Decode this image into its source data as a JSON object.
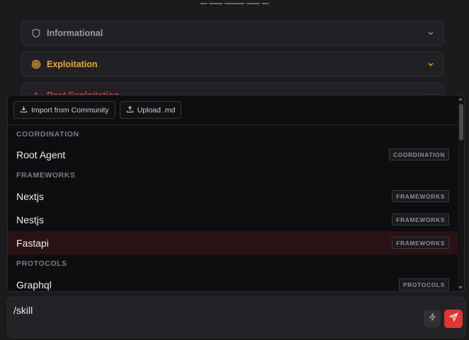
{
  "top_fragment": "▁ ▁▁ ▁▁▁  ▁▁ ▁",
  "categories": [
    {
      "label": "Informational",
      "icon": "shield-icon",
      "color": "#9a9aa0"
    },
    {
      "label": "Exploitation",
      "icon": "target-icon",
      "color": "#f5a524"
    },
    {
      "label": "Post Exploitation",
      "icon": "post-exploit-icon",
      "color": "#c24141"
    }
  ],
  "popover": {
    "import_label": "Import from Community",
    "upload_label": "Upload .md",
    "sections": [
      {
        "title": "COORDINATION",
        "items": [
          {
            "name": "Root Agent",
            "tag": "COORDINATION"
          }
        ]
      },
      {
        "title": "FRAMEWORKS",
        "items": [
          {
            "name": "Nextjs",
            "tag": "FRAMEWORKS"
          },
          {
            "name": "Nestjs",
            "tag": "FRAMEWORKS"
          },
          {
            "name": "Fastapi",
            "tag": "FRAMEWORKS",
            "highlighted": true
          }
        ]
      },
      {
        "title": "PROTOCOLS",
        "items": [
          {
            "name": "Graphql",
            "tag": "PROTOCOLS"
          }
        ]
      }
    ]
  },
  "composer": {
    "value": "/skill",
    "skill_icon": "lightning-icon",
    "send_icon": "send-icon",
    "send_color": "#e3342f"
  }
}
